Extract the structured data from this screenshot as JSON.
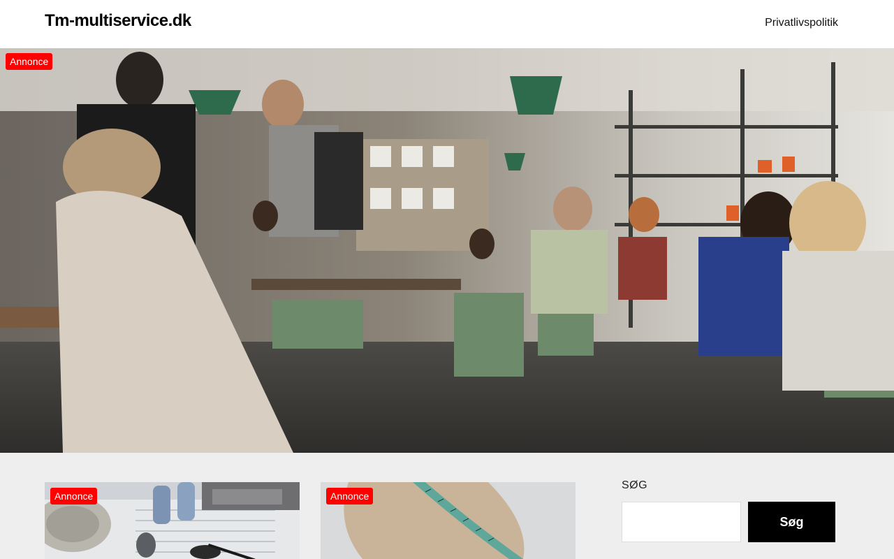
{
  "header": {
    "site_title": "Tm-multiservice.dk",
    "nav": [
      {
        "label": "Privatlivspolitik"
      }
    ]
  },
  "hero": {
    "badge": "Annonce",
    "image": "cafe-interior-photo"
  },
  "cards": [
    {
      "badge": "Annonce",
      "image": "desk-paperwork-photo"
    },
    {
      "badge": "Annonce",
      "image": "tailor-measuring-tape-photo"
    }
  ],
  "search": {
    "label": "SØG",
    "input_value": "",
    "placeholder": "",
    "button_label": "Søg"
  },
  "colors": {
    "badge": "#ff0000",
    "page_bg": "#eeeeee",
    "search_button": "#000000"
  }
}
